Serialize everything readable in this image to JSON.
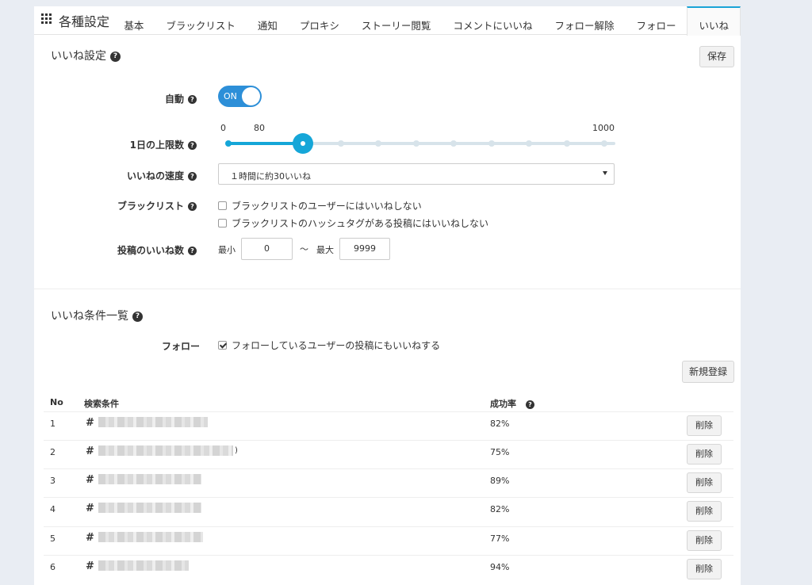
{
  "app": {
    "title": "各種設定"
  },
  "tabs": [
    {
      "label": "基本"
    },
    {
      "label": "ブラックリスト"
    },
    {
      "label": "通知"
    },
    {
      "label": "プロキシ"
    },
    {
      "label": "ストーリー閲覧"
    },
    {
      "label": "コメントにいいね"
    },
    {
      "label": "フォロー解除"
    },
    {
      "label": "フォロー"
    },
    {
      "label": "いいね",
      "active": true
    }
  ],
  "like_settings": {
    "title": "いいね設定",
    "save_label": "保存",
    "auto": {
      "label": "自動",
      "state": "ON",
      "on": true
    },
    "daily_limit": {
      "label": "1日の上限数",
      "min_label": "0",
      "value_label": "80",
      "max_label": "1000",
      "value": 80,
      "min": 0,
      "max": 1000
    },
    "speed": {
      "label": "いいねの速度",
      "selected": "１時間に約30いいね"
    },
    "blacklist": {
      "label": "ブラックリスト",
      "options": [
        {
          "text": "ブラックリストのユーザーにはいいねしない",
          "checked": false
        },
        {
          "text": "ブラックリストのハッシュタグがある投稿にはいいねしない",
          "checked": false
        }
      ]
    },
    "post_likes": {
      "label": "投稿のいいね数",
      "min_label": "最小",
      "min_value": "0",
      "separator": "〜",
      "max_label": "最大",
      "max_value": "9999"
    }
  },
  "conditions": {
    "title": "いいね条件一覧",
    "follow": {
      "label": "フォロー",
      "text": "フォローしているユーザーの投稿にもいいねする",
      "checked": true
    },
    "new_label": "新規登録",
    "headers": {
      "no": "No",
      "criteria": "検索条件",
      "rate": "成功率"
    },
    "delete_label": "削除",
    "rows": [
      {
        "no": "1",
        "rate": "82%"
      },
      {
        "no": "2",
        "rate": "75%",
        "suffix": ")"
      },
      {
        "no": "3",
        "rate": "89%"
      },
      {
        "no": "4",
        "rate": "82%"
      },
      {
        "no": "5",
        "rate": "77%"
      },
      {
        "no": "6",
        "rate": "94%"
      }
    ]
  },
  "colors": {
    "accent": "#15a6d8",
    "toggle": "#2d8fd8",
    "background": "#e9edf3"
  },
  "icons": {
    "menu": "grid-icon",
    "help": "question-circle-icon",
    "hash": "hashtag-icon"
  }
}
